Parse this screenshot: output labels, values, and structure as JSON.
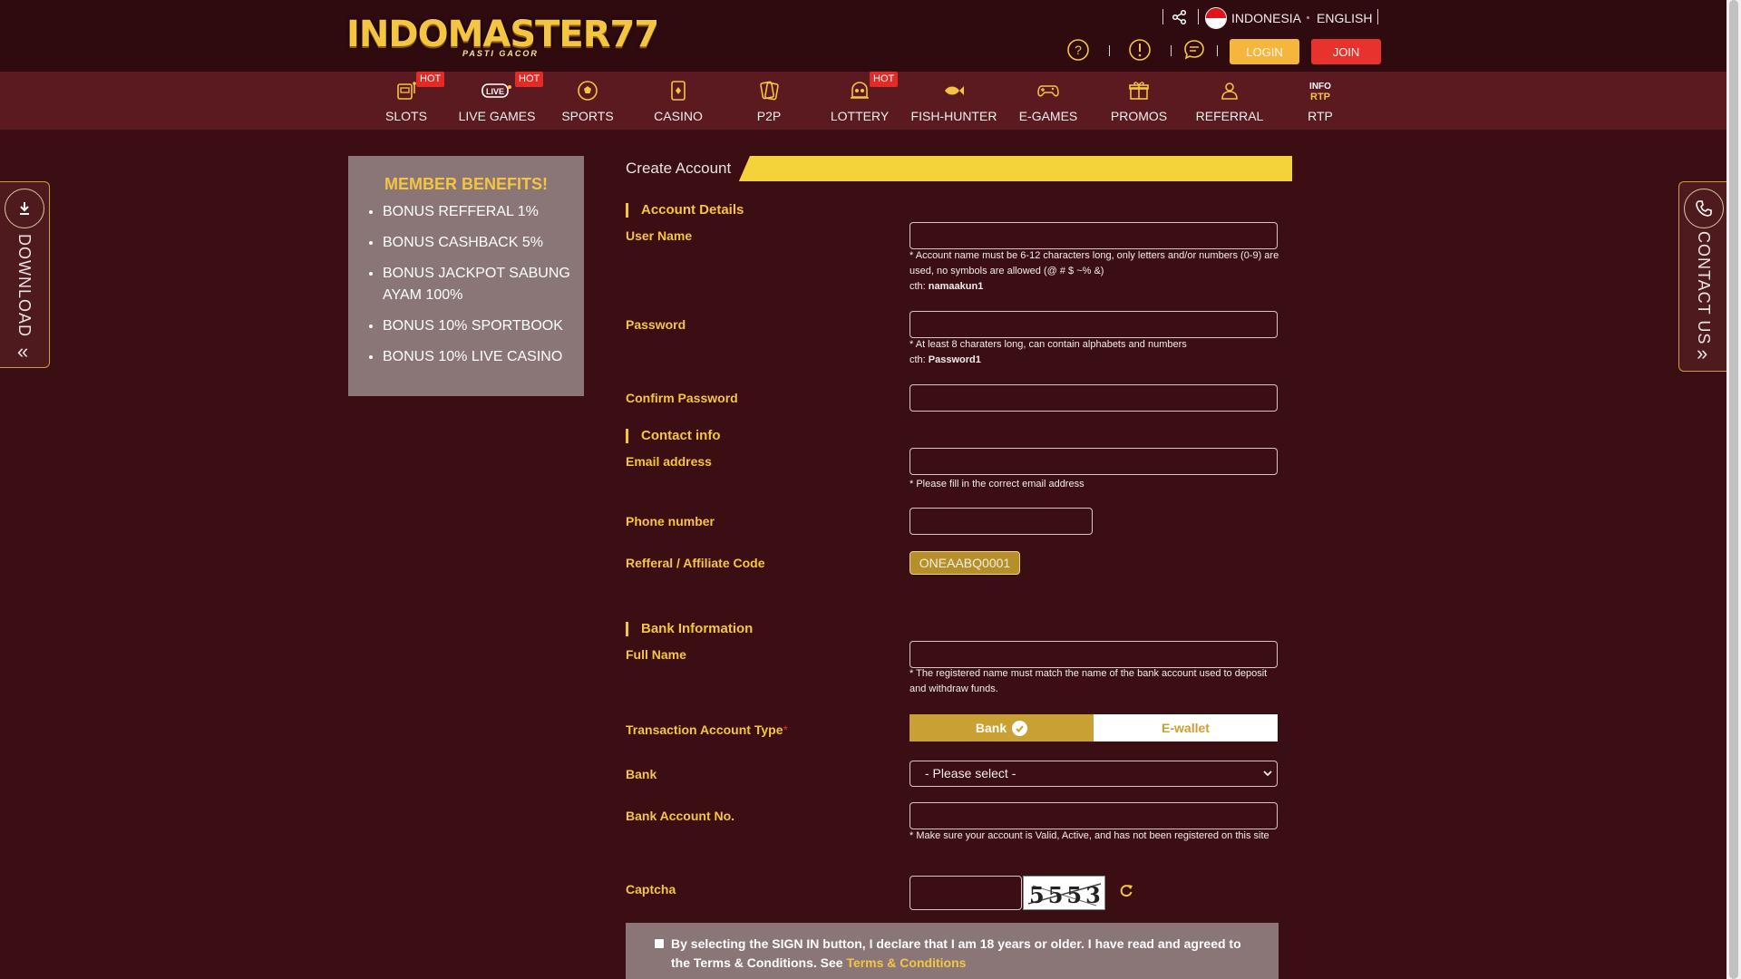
{
  "header": {
    "logo_text": "INDOMASTER77",
    "logo_tagline": "PASTI GACOR",
    "lang_indonesia": "INDONESIA",
    "lang_english": "ENGLISH",
    "login_label": "LOGIN",
    "join_label": "JOIN"
  },
  "nav": {
    "items": [
      {
        "label": "SLOTS",
        "icon": "slot-machine-icon",
        "hot": "HOT"
      },
      {
        "label": "LIVE GAMES",
        "icon": "live-icon",
        "hot": "HOT"
      },
      {
        "label": "SPORTS",
        "icon": "soccer-ball-icon"
      },
      {
        "label": "CASINO",
        "icon": "playing-card-icon"
      },
      {
        "label": "P2P",
        "icon": "cards-icon"
      },
      {
        "label": "LOTTERY",
        "icon": "lottery-icon",
        "hot": "HOT"
      },
      {
        "label": "FISH-HUNTER",
        "icon": "fish-icon"
      },
      {
        "label": "E-GAMES",
        "icon": "gamepad-icon"
      },
      {
        "label": "PROMOS",
        "icon": "gift-icon"
      },
      {
        "label": "REFERRAL",
        "icon": "referral-icon"
      },
      {
        "label": "RTP",
        "icon": "info-rtp-icon"
      }
    ]
  },
  "side": {
    "download_label": "DOWNLOAD",
    "download_chev": "«",
    "contact_label": "CONTACT US",
    "contact_chev": "»"
  },
  "benefits": {
    "title": "MEMBER BENEFITS!",
    "items": [
      "BONUS REFFERAL 1%",
      "BONUS CASHBACK 5%",
      "BONUS JACKPOT SABUNG AYAM 100%",
      "BONUS 10% SPORTBOOK",
      "BONUS 10% LIVE CASINO"
    ]
  },
  "form": {
    "title": "Create Account",
    "account_details": "Account Details",
    "username_label": "User Name",
    "username_hint": "* Account name must be 6-12 characters long, only letters and/or numbers (0-9) are used, no symbols are allowed (@ # $ ~% &)",
    "username_example_prefix": "cth: ",
    "username_example": "namaakun1",
    "password_label": "Password",
    "password_hint": "* At least 8 charaters long, can contain alphabets and numbers",
    "password_example_prefix": "cth: ",
    "password_example": "Password1",
    "confirm_label": "Confirm Password",
    "contact_info": "Contact info",
    "email_label": "Email address",
    "email_hint": "* Please fill in the correct email address",
    "phone_label": "Phone number",
    "referral_label": "Refferal / Affiliate Code",
    "referral_code": "ONEAABQ0001",
    "bank_information": "Bank Information",
    "fullname_label": "Full Name",
    "fullname_hint": "* The registered name must match the name of the bank account used to deposit and withdraw funds.",
    "txn_type_label": "Transaction Account Type",
    "txn_type_required": "*",
    "type_bank": "Bank",
    "type_ewallet": "E-wallet",
    "bank_label": "Bank",
    "bank_placeholder": "- Please select -",
    "bank_acc_label": "Bank Account No.",
    "bank_acc_hint": "* Make sure your account is Valid, Active, and has not been registered on this site",
    "captcha_label": "Captcha",
    "captcha_code": "5553",
    "agree_text": "By selecting the SIGN IN button, I declare that I am 18 years or older. I have read and agreed to the Terms & Conditions. See ",
    "agree_link": "Terms & Conditions"
  }
}
